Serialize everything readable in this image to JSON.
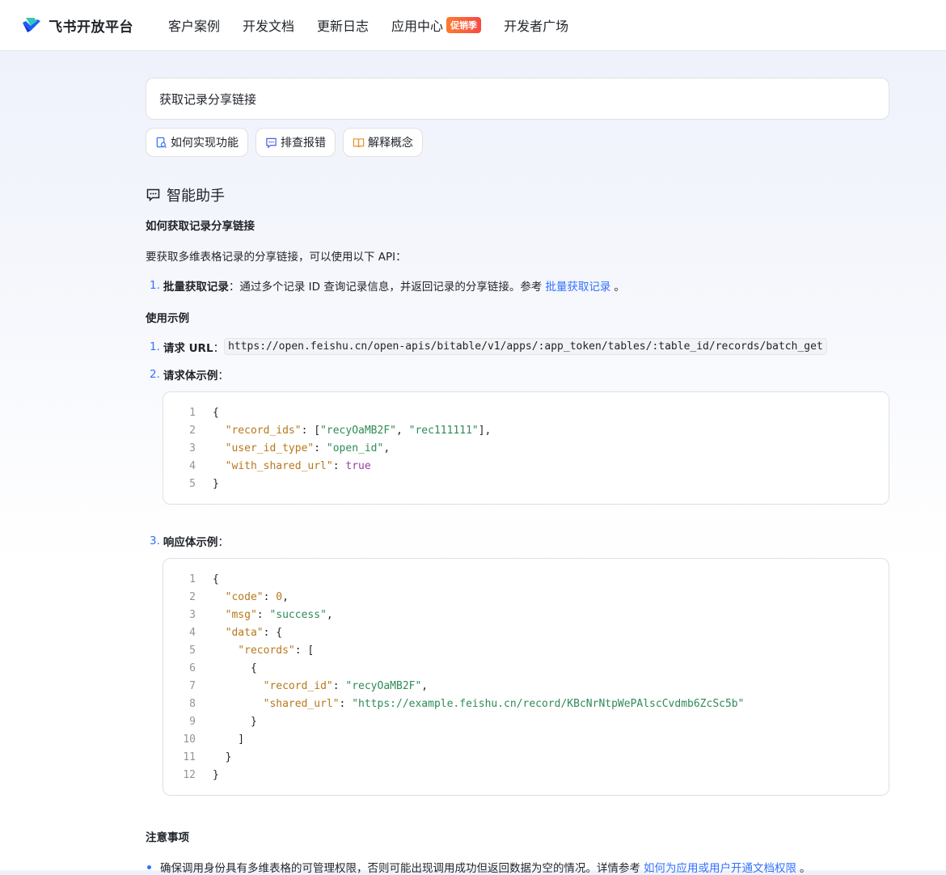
{
  "header": {
    "brand": "飞书开放平台",
    "nav": [
      {
        "label": "客户案例"
      },
      {
        "label": "开发文档"
      },
      {
        "label": "更新日志"
      },
      {
        "label": "应用中心",
        "badge": "促销季"
      },
      {
        "label": "开发者广场"
      }
    ]
  },
  "search": {
    "value": "获取记录分享链接"
  },
  "chips": [
    {
      "label": "如何实现功能",
      "icon": "doc-search-icon"
    },
    {
      "label": "排查报错",
      "icon": "chat-bug-icon"
    },
    {
      "label": "解释概念",
      "icon": "book-icon"
    }
  ],
  "assistant": {
    "title": "智能助手",
    "heading": "如何获取记录分享链接",
    "intro": "要获取多维表格记录的分享链接，可以使用以下 API：",
    "api_item": {
      "num": "1.",
      "bold": "批量获取记录",
      "text": "：通过多个记录 ID 查询记录信息，并返回记录的分享链接。参考",
      "link": "批量获取记录",
      "tail": "。"
    },
    "usage_heading": "使用示例",
    "steps": [
      {
        "num": "1.",
        "label": "请求 URL",
        "sep": "：",
        "code": "https://open.feishu.cn/open-apis/bitable/v1/apps/:app_token/tables/:table_id/records/batch_get"
      },
      {
        "num": "2.",
        "label": "请求体示例",
        "sep": "："
      },
      {
        "num": "3.",
        "label": "响应体示例",
        "sep": "："
      }
    ],
    "notes_heading": "注意事项",
    "note": {
      "text": "确保调用身份具有多维表格的可管理权限，否则可能出现调用成功但返回数据为空的情况。详情参考",
      "link": "如何为应用或用户开通文档权限",
      "tail": "。"
    }
  },
  "request_code": [
    "{",
    "  \"record_ids\": [\"recyOaMB2F\", \"rec111111\"],",
    "  \"user_id_type\": \"open_id\",",
    "  \"with_shared_url\": true",
    "}"
  ],
  "response_code": [
    "{",
    "  \"code\": 0,",
    "  \"msg\": \"success\",",
    "  \"data\": {",
    "    \"records\": [",
    "      {",
    "        \"record_id\": \"recyOaMB2F\",",
    "        \"shared_url\": \"https://example.feishu.cn/record/KBcNrNtpWePAlscCvdmb6ZcSc5b\"",
    "      }",
    "    ]",
    "  }",
    "}"
  ],
  "colors": {
    "accent": "#3370ff",
    "badge_start": "#ff7a2e",
    "badge_end": "#f54a45"
  }
}
